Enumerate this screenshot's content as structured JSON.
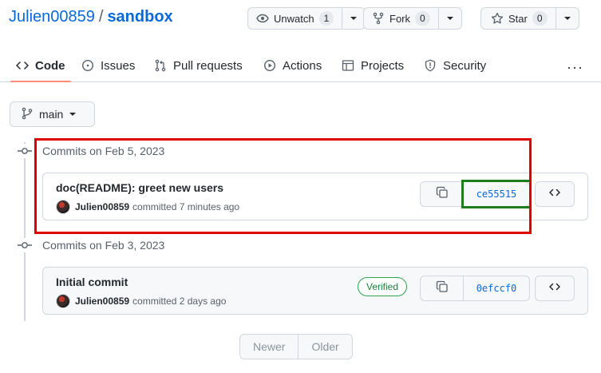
{
  "repo": {
    "owner": "Julien00859",
    "separator": "/",
    "name": "sandbox"
  },
  "actions": {
    "watch": {
      "label": "Unwatch",
      "count": "1"
    },
    "fork": {
      "label": "Fork",
      "count": "0"
    },
    "star": {
      "label": "Star",
      "count": "0"
    }
  },
  "tabs": [
    {
      "label": "Code",
      "icon": "code-icon",
      "active": true
    },
    {
      "label": "Issues",
      "icon": "issue-icon"
    },
    {
      "label": "Pull requests",
      "icon": "pull-request-icon"
    },
    {
      "label": "Actions",
      "icon": "play-icon"
    },
    {
      "label": "Projects",
      "icon": "table-icon"
    },
    {
      "label": "Security",
      "icon": "shield-icon"
    }
  ],
  "more_label": "···",
  "branch": {
    "label": "main"
  },
  "groups": [
    {
      "heading": "Commits on Feb 5, 2023",
      "commits": [
        {
          "title": "doc(README): greet new users",
          "author": "Julien00859",
          "meta": "committed 7 minutes ago",
          "sha": "ce55515"
        }
      ]
    },
    {
      "heading": "Commits on Feb 3, 2023",
      "commits": [
        {
          "title": "Initial commit",
          "author": "Julien00859",
          "meta": "committed 2 days ago",
          "sha": "0efccf0",
          "badge": "Verified"
        }
      ]
    }
  ],
  "pagination": {
    "newer": "Newer",
    "older": "Older"
  },
  "colors": {
    "link": "#0969da",
    "active_tab_underline": "#fd8c73",
    "highlight_red": "#e00000",
    "highlight_green": "#1e7d1e",
    "verified": "#1a7f37"
  }
}
